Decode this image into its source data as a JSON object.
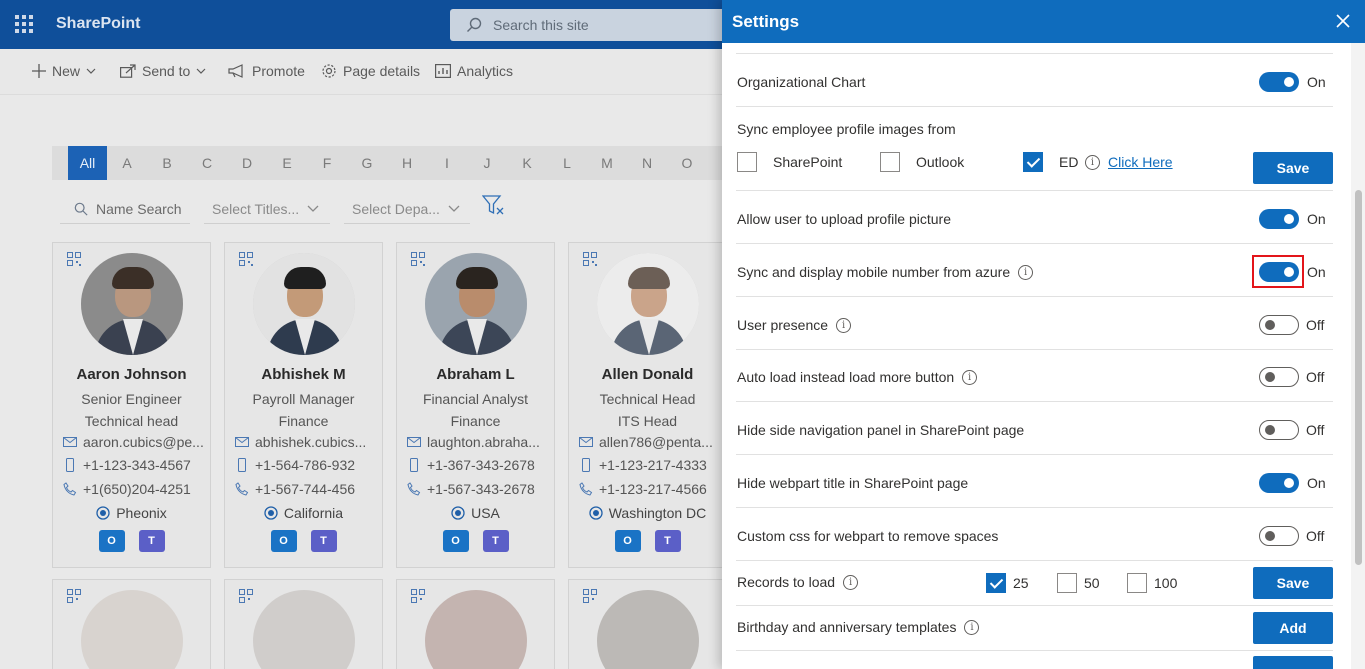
{
  "suite": {
    "app_name": "SharePoint",
    "search_placeholder": "Search this site"
  },
  "commandbar": {
    "new": "New",
    "send_to": "Send to",
    "promote": "Promote",
    "page_details": "Page details",
    "analytics": "Analytics"
  },
  "alphabet": [
    "All",
    "A",
    "B",
    "C",
    "D",
    "E",
    "F",
    "G",
    "H",
    "I",
    "J",
    "K",
    "L",
    "M",
    "N",
    "O"
  ],
  "filters": {
    "name_search": "Name Search",
    "titles": "Select Titles...",
    "departments": "Select Depa..."
  },
  "employees": [
    {
      "name": "Aaron Johnson",
      "title": "Senior Engineer",
      "dept": "Technical head",
      "email": "aaron.cubics@pe...",
      "mobile": "+1-123-343-4567",
      "phone": "+1(650)204-4251",
      "location": "Pheonix"
    },
    {
      "name": "Abhishek M",
      "title": "Payroll Manager",
      "dept": "Finance",
      "email": "abhishek.cubics...",
      "mobile": "+1-564-786-932",
      "phone": "+1-567-744-456",
      "location": "California"
    },
    {
      "name": "Abraham L",
      "title": "Financial Analyst",
      "dept": "Finance",
      "email": "laughton.abraha...",
      "mobile": "+1-367-343-2678",
      "phone": "+1-567-343-2678",
      "location": "USA"
    },
    {
      "name": "Allen Donald",
      "title": "Technical Head",
      "dept": "ITS Head",
      "email": "allen786@penta...",
      "mobile": "+1-123-217-4333",
      "phone": "+1-123-217-4566",
      "location": "Washington DC"
    }
  ],
  "app_badges": {
    "outlook": "O",
    "teams": "T"
  },
  "settings": {
    "title": "Settings",
    "org_chart": {
      "label": "Organizational Chart",
      "state": "On"
    },
    "sync_images": {
      "label": "Sync employee profile images from",
      "options": [
        {
          "label": "SharePoint",
          "checked": false
        },
        {
          "label": "Outlook",
          "checked": false
        },
        {
          "label": "ED",
          "checked": true
        }
      ],
      "link": "Click Here",
      "save": "Save"
    },
    "upload_picture": {
      "label": "Allow user to upload profile picture",
      "state": "On"
    },
    "sync_mobile": {
      "label": "Sync and display mobile number from azure",
      "state": "On"
    },
    "user_presence": {
      "label": "User presence",
      "state": "Off"
    },
    "auto_load": {
      "label": "Auto load instead load more button",
      "state": "Off"
    },
    "hide_sidenav": {
      "label": "Hide side navigation panel in SharePoint page",
      "state": "Off"
    },
    "hide_title": {
      "label": "Hide webpart title in SharePoint page",
      "state": "On"
    },
    "custom_css": {
      "label": "Custom css for webpart to remove spaces",
      "state": "Off"
    },
    "records": {
      "label": "Records to load",
      "options": [
        {
          "label": "25",
          "checked": true
        },
        {
          "label": "50",
          "checked": false
        },
        {
          "label": "100",
          "checked": false
        }
      ],
      "save": "Save"
    },
    "templates": {
      "label": "Birthday and anniversary templates",
      "add": "Add"
    }
  },
  "colors": {
    "brand": "#0f6cbd",
    "suitebar": "#0f4f9a",
    "highlight": "#e3151a"
  }
}
